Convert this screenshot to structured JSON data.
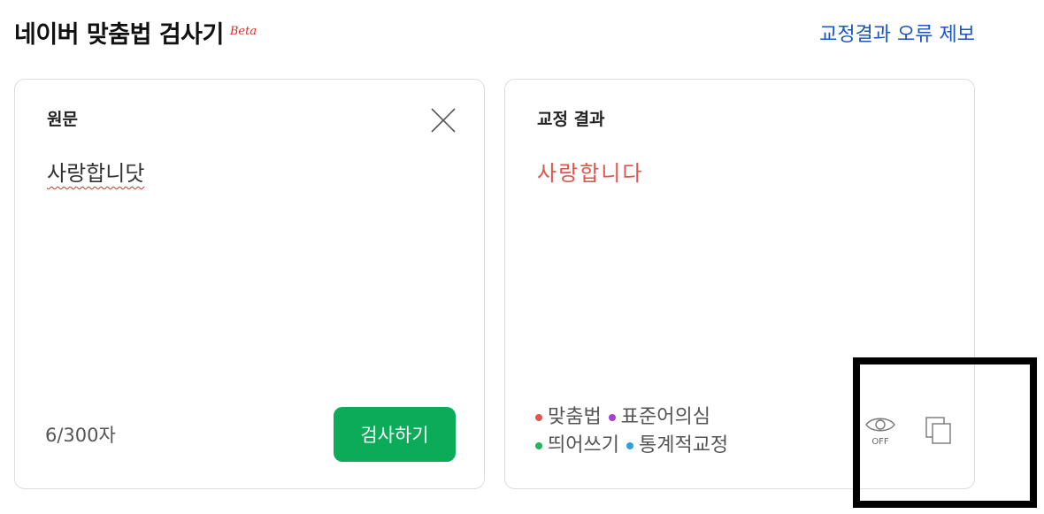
{
  "header": {
    "title": "네이버 맞춤법 검사기",
    "beta": "Beta",
    "report_link": "교정결과 오류 제보"
  },
  "source_panel": {
    "title": "원문",
    "text": "사랑합니닷",
    "char_count": "6/300자",
    "check_button": "검사하기",
    "close_icon": "close-icon"
  },
  "result_panel": {
    "title": "교정 결과",
    "text": "사랑합니다",
    "legend": [
      {
        "label": "맞춤법",
        "color": "#e5534b"
      },
      {
        "label": "표준어의심",
        "color": "#a53fd6"
      },
      {
        "label": "띄어쓰기",
        "color": "#1db954"
      },
      {
        "label": "통계적교정",
        "color": "#2f9fe0"
      }
    ],
    "view_toggle_label": "OFF",
    "eye_icon": "eye-icon",
    "copy_icon": "copy-icon"
  },
  "colors": {
    "accent_green": "#0bab5a",
    "link_blue": "#1a56c7",
    "error_red": "#e5534b"
  }
}
